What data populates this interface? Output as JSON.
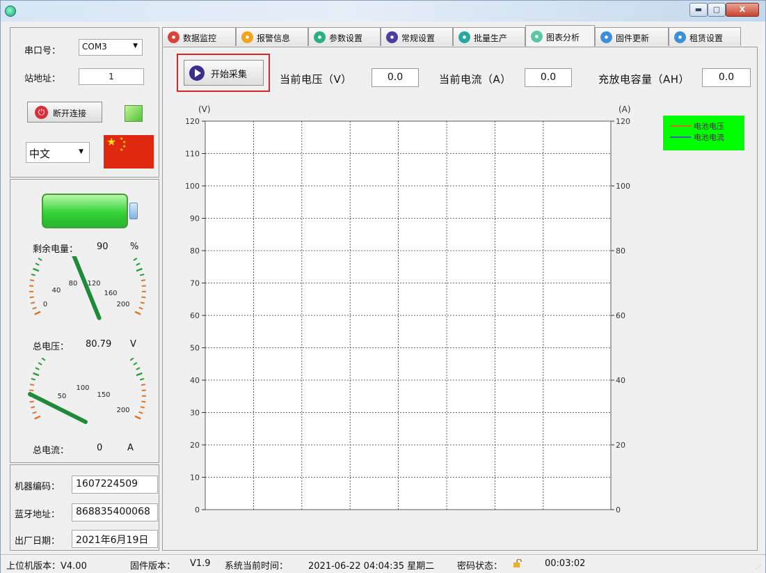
{
  "window": {
    "min_label": "▬",
    "max_label": "▢",
    "close_label": "X"
  },
  "connection": {
    "port_label": "串口号：",
    "port_value": "COM3",
    "station_label": "站地址：",
    "station_value": "1",
    "disconnect_label": "断开连接",
    "language_value": "中文"
  },
  "status": {
    "remaining_label": "剩余电量：",
    "remaining_value": "90",
    "remaining_unit": "%",
    "voltage_label": "总电压：",
    "voltage_value": "80.79",
    "voltage_unit": "V",
    "current_label": "总电流：",
    "current_value": "0",
    "current_unit": "A",
    "voltage_gauge": {
      "ticks": [
        "0",
        "40",
        "80",
        "120",
        "160",
        "200"
      ],
      "needle_value": 80.79,
      "max": 200
    },
    "current_gauge": {
      "ticks": [
        "50",
        "100",
        "150",
        "200"
      ],
      "needle_value": 0,
      "max": 200
    }
  },
  "info": {
    "machine_label": "机器编码：",
    "machine_value": "1607224509",
    "bt_label": "蓝牙地址：",
    "bt_value": "868835400068",
    "date_label": "出厂日期：",
    "date_value": "2021年6月19日"
  },
  "tabs": [
    {
      "label": "数据监控",
      "icon": "home-icon",
      "color": "#d9433b",
      "active": false
    },
    {
      "label": "报警信息",
      "icon": "alarm-icon",
      "color": "#f0a520",
      "active": false
    },
    {
      "label": "参数设置",
      "icon": "settings-icon",
      "color": "#2bb07e",
      "active": false
    },
    {
      "label": "常规设置",
      "icon": "general-icon",
      "color": "#4b3ea0",
      "active": false
    },
    {
      "label": "批量生产",
      "icon": "production-icon",
      "color": "#27a8a0",
      "active": false
    },
    {
      "label": "图表分析",
      "icon": "chart-icon",
      "color": "#5cc7a8",
      "active": true
    },
    {
      "label": "固件更新",
      "icon": "firmware-icon",
      "color": "#3d8fd8",
      "active": false
    },
    {
      "label": "租赁设置",
      "icon": "lease-icon",
      "color": "#3d8fd8",
      "active": false
    }
  ],
  "toolbar": {
    "start_label": "开始采集",
    "voltage_label": "当前电压（V）",
    "voltage_value": "0.0",
    "current_label": "当前电流（A）",
    "current_value": "0.0",
    "capacity_label": "充放电容量（AH）",
    "capacity_value": "0.0"
  },
  "chart_data": {
    "type": "line",
    "left_axis_unit": "(V)",
    "right_axis_unit": "(A)",
    "ylim_left": [
      0,
      120
    ],
    "yticks_left": [
      0,
      10,
      20,
      30,
      40,
      50,
      60,
      70,
      80,
      90,
      100,
      110,
      120
    ],
    "ylim_right": [
      0,
      120
    ],
    "yticks_right": [
      0,
      20,
      40,
      60,
      80,
      100,
      120
    ],
    "grid": true,
    "legend_position": "top-right",
    "series": [
      {
        "name": "电池电压",
        "color": "#d06a2a",
        "values": []
      },
      {
        "name": "电池电流",
        "color": "#3a5fb0",
        "values": []
      }
    ]
  },
  "statusbar": {
    "host_version": "上位机版本：V4.00",
    "fw_version_label": "固件版本：",
    "fw_version_value": "V1.9",
    "time_label": "系统当前时间：",
    "time_value": "2021-06-22 04:04:35 星期二",
    "pwd_label": "密码状态：",
    "elapsed": "00:03:02"
  }
}
